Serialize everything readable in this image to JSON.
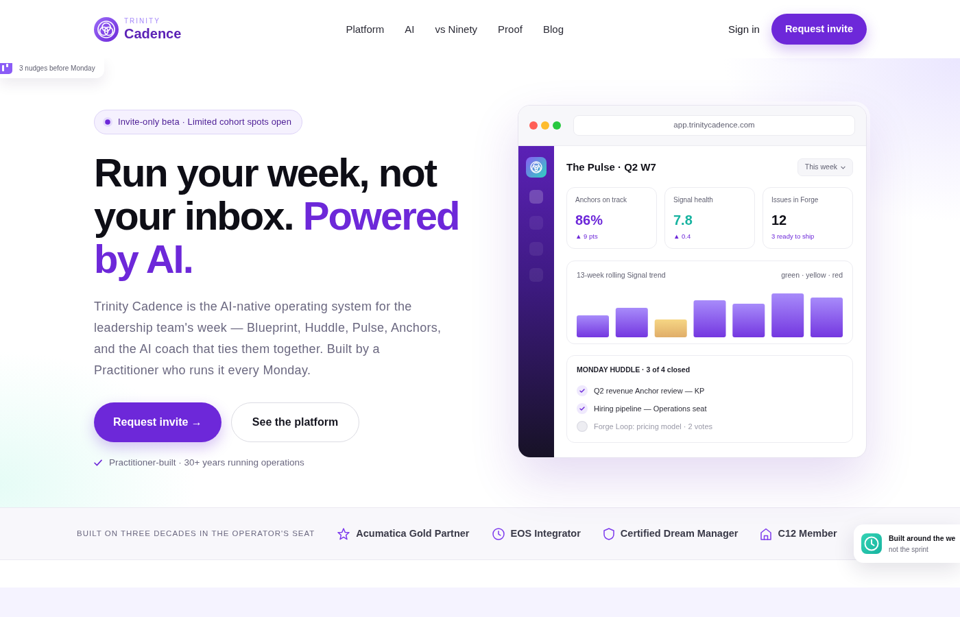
{
  "header": {
    "logo": {
      "eyebrow": "TRINITY",
      "name": "Cadence"
    },
    "nav": [
      "Platform",
      "AI",
      "vs Ninety",
      "Proof",
      "Blog"
    ],
    "sign_in": "Sign in",
    "cta": "Request invite"
  },
  "nudge_card": {
    "text": "3 nudges before Monday"
  },
  "hero": {
    "badge": "Invite-only beta · Limited cohort spots open",
    "headline": "Run your week, not your inbox.",
    "headline_accent": "Powered by AI.",
    "lede": "Trinity Cadence is the AI-native operating system for the leadership team's week — Blueprint, Huddle, Pulse, Anchors, and the AI coach that ties them together. Built by a Practitioner who runs it every Monday.",
    "buttons": [
      {
        "label": "Request invite →",
        "kind": "primary"
      },
      {
        "label": "See the platform",
        "kind": "outline"
      }
    ],
    "proof": "Practitioner-built · 30+ years running operations"
  },
  "app_preview": {
    "url": "app.trinitycadence.com",
    "sidebar_items": [
      {
        "selected": true
      },
      {
        "selected": false
      },
      {
        "selected": false
      },
      {
        "selected": false
      }
    ],
    "title": "The Pulse · Q2 W7",
    "period": "This week",
    "stats": [
      {
        "label": "Anchors on track",
        "value": "86%",
        "color": "#6d28d9",
        "delta": "▲ 9 pts"
      },
      {
        "label": "Signal health",
        "value": "7.8",
        "color": "#17b3a0",
        "delta": "▲ 0.4"
      },
      {
        "label": "Issues in Forge",
        "value": "12",
        "color": "#111118",
        "delta": "3 ready to ship"
      }
    ],
    "trend": {
      "title": "13-week rolling Signal trend",
      "legend": "green · yellow · red"
    },
    "huddle": {
      "title": "MONDAY HUDDLE · 3 of 4 closed",
      "items": [
        {
          "text": "Q2 revenue Anchor review — KP",
          "checked": true
        },
        {
          "text": "Hiring pipeline — Operations seat",
          "checked": true
        },
        {
          "text": "Forge Loop: pricing model · 2 votes",
          "checked": false
        }
      ]
    }
  },
  "credentials": {
    "label": "BUILT ON THREE DECADES IN THE OPERATOR'S SEAT",
    "items": [
      {
        "kind": "star",
        "text": "Acumatica Gold Partner"
      },
      {
        "kind": "clock",
        "text": "EOS Integrator"
      },
      {
        "kind": "shield",
        "text": "Certified Dream Manager"
      },
      {
        "kind": "building",
        "text": "C12 Member"
      }
    ]
  },
  "week_card": {
    "title": "Built around the we",
    "subtitle": "not the sprint"
  }
}
